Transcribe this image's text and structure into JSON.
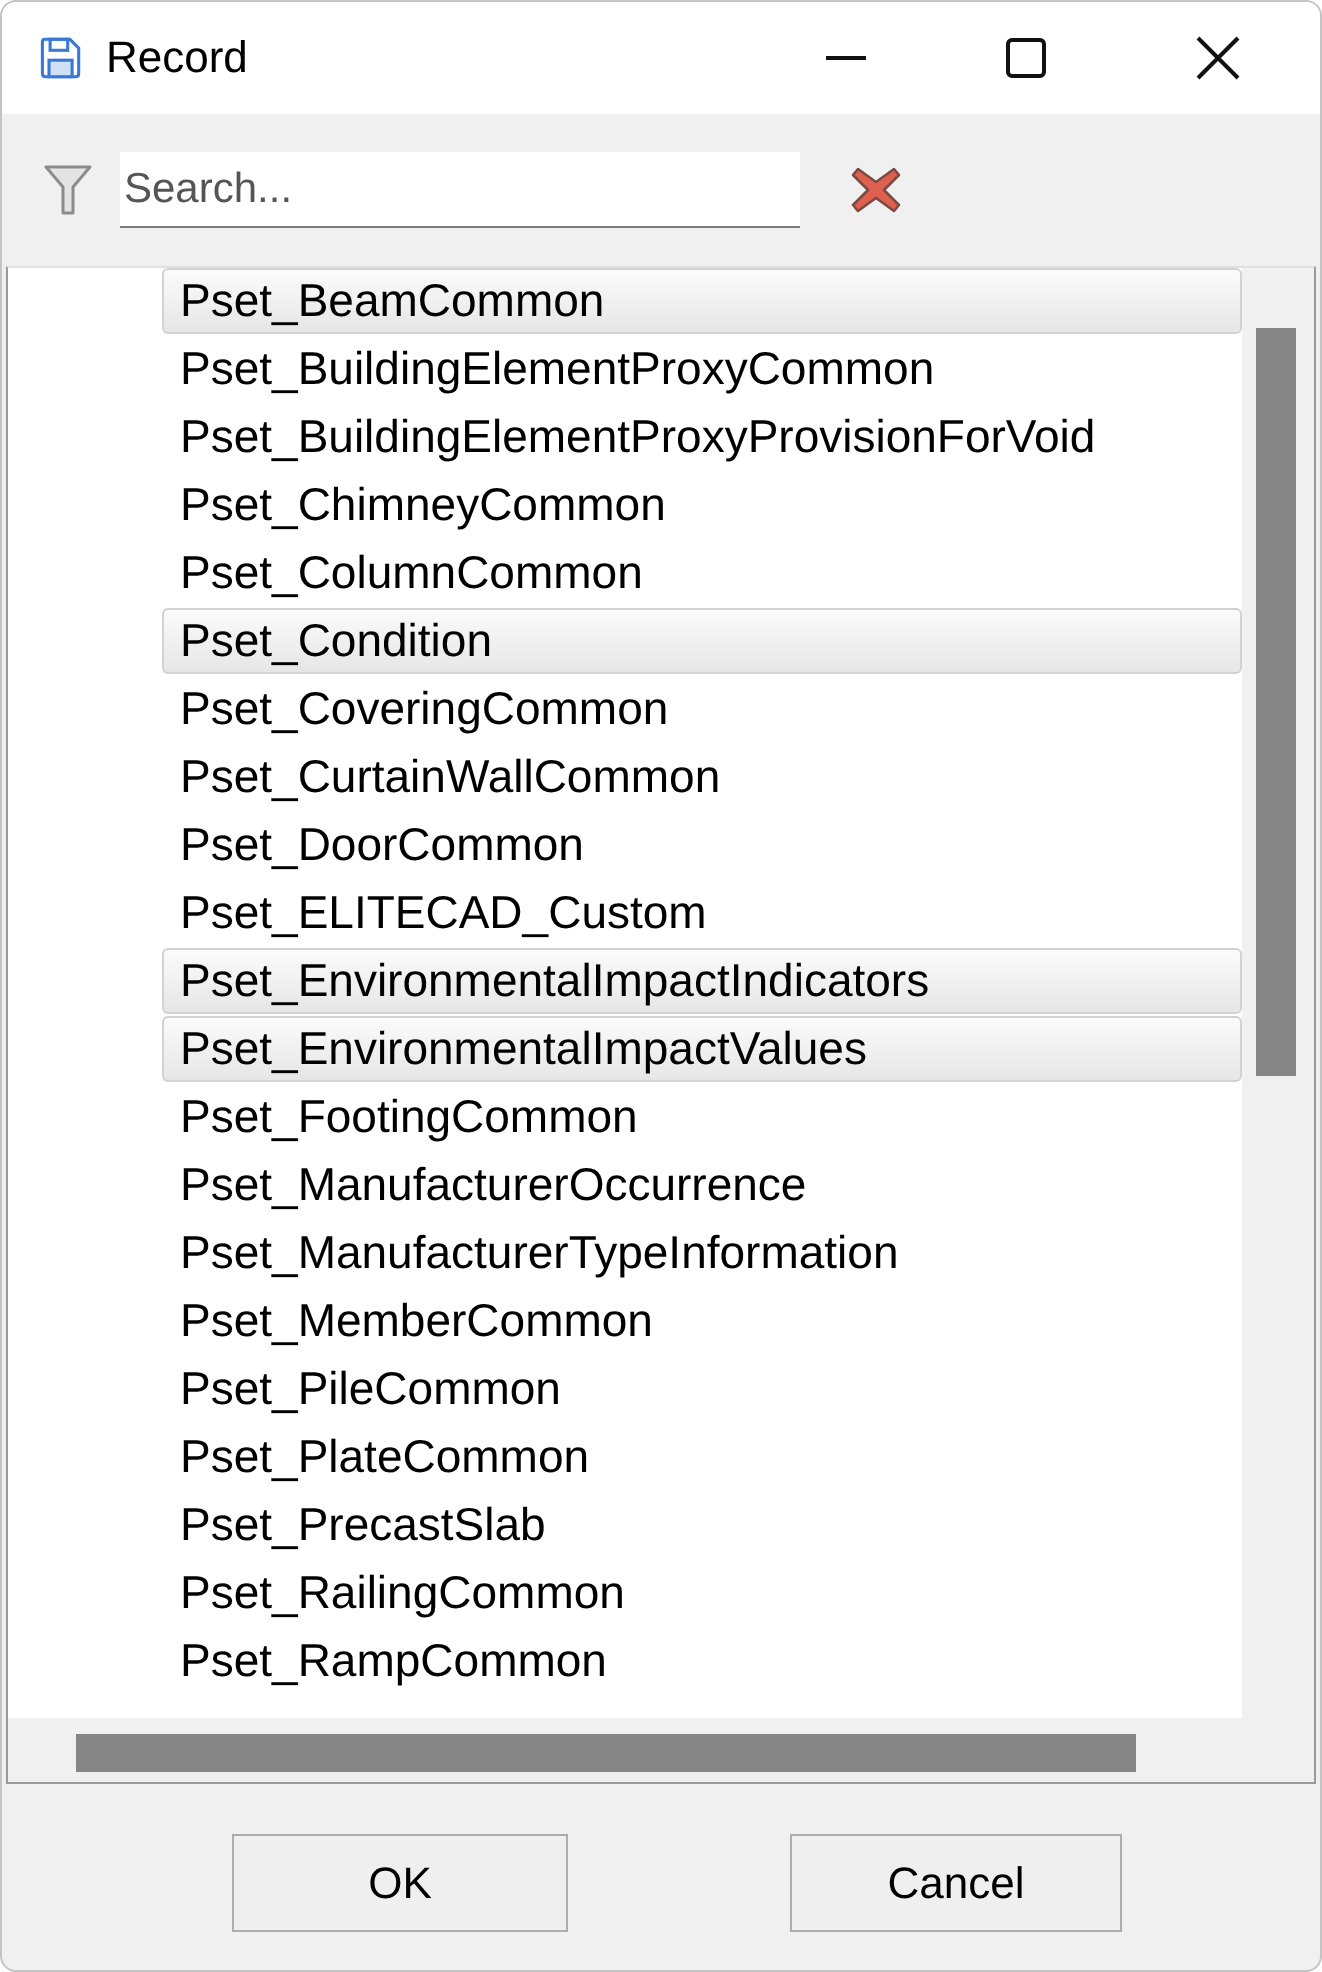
{
  "window": {
    "title": "Record"
  },
  "search": {
    "placeholder": "Search..."
  },
  "list": {
    "items": [
      {
        "label": "Pset_BeamCommon",
        "selected": true
      },
      {
        "label": "Pset_BuildingElementProxyCommon",
        "selected": false
      },
      {
        "label": "Pset_BuildingElementProxyProvisionForVoid",
        "selected": false
      },
      {
        "label": "Pset_ChimneyCommon",
        "selected": false
      },
      {
        "label": "Pset_ColumnCommon",
        "selected": false
      },
      {
        "label": "Pset_Condition",
        "selected": true
      },
      {
        "label": "Pset_CoveringCommon",
        "selected": false
      },
      {
        "label": "Pset_CurtainWallCommon",
        "selected": false
      },
      {
        "label": "Pset_DoorCommon",
        "selected": false
      },
      {
        "label": "Pset_ELITECAD_Custom",
        "selected": false
      },
      {
        "label": "Pset_EnvironmentalImpactIndicators",
        "selected": true
      },
      {
        "label": "Pset_EnvironmentalImpactValues",
        "selected": true
      },
      {
        "label": "Pset_FootingCommon",
        "selected": false
      },
      {
        "label": "Pset_ManufacturerOccurrence",
        "selected": false
      },
      {
        "label": "Pset_ManufacturerTypeInformation",
        "selected": false
      },
      {
        "label": "Pset_MemberCommon",
        "selected": false
      },
      {
        "label": "Pset_PileCommon",
        "selected": false
      },
      {
        "label": "Pset_PlateCommon",
        "selected": false
      },
      {
        "label": "Pset_PrecastSlab",
        "selected": false
      },
      {
        "label": "Pset_RailingCommon",
        "selected": false
      },
      {
        "label": "Pset_RampCommon",
        "selected": false
      }
    ]
  },
  "buttons": [
    {
      "label": "OK"
    },
    {
      "label": "Cancel"
    }
  ]
}
